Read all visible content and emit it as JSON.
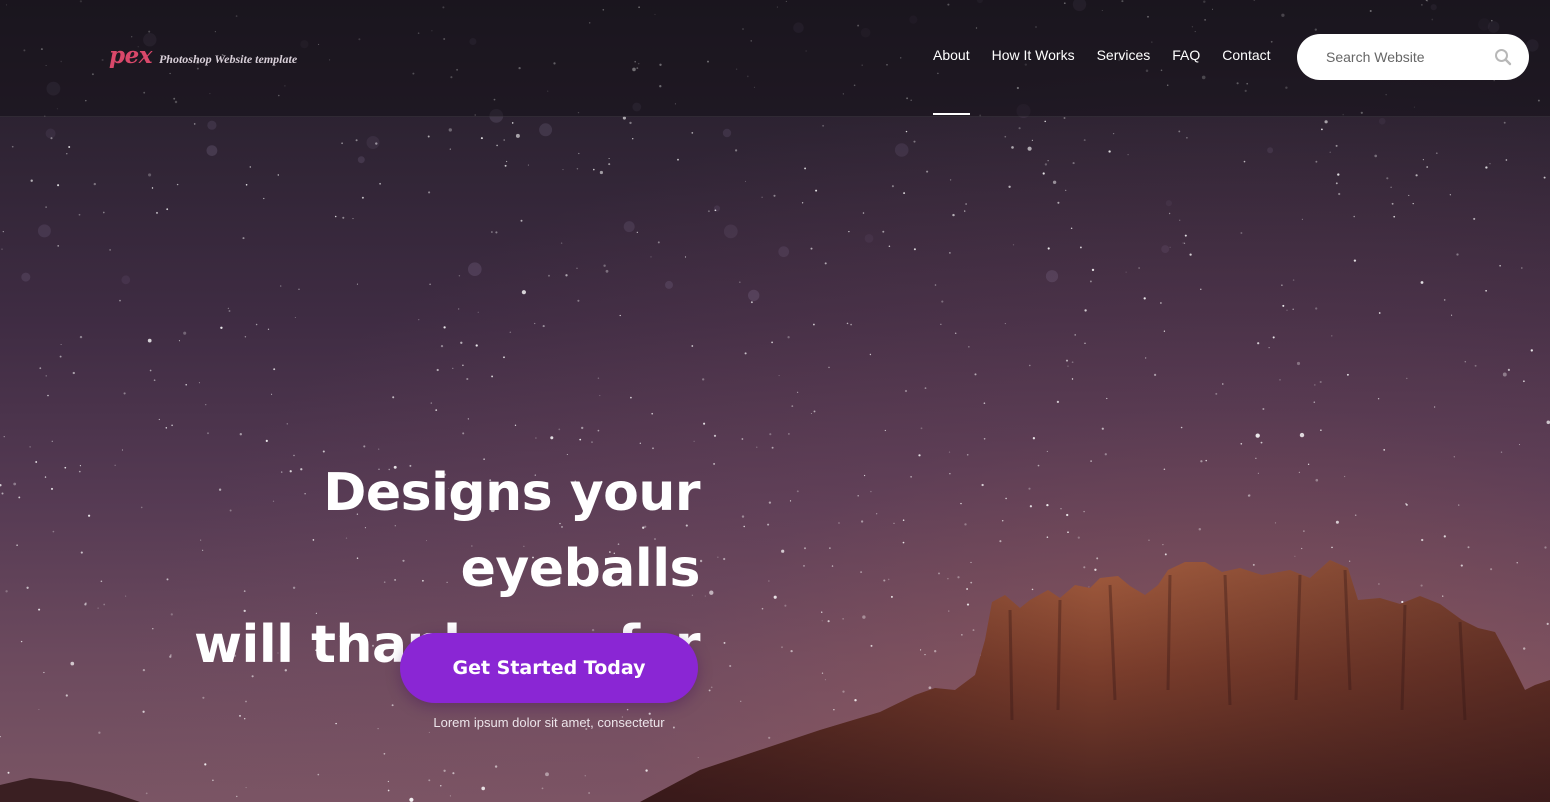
{
  "header": {
    "logo_mark": "pex",
    "logo_tagline": "Photoshop Website template",
    "nav": [
      {
        "label": "About",
        "active": true
      },
      {
        "label": "How It Works",
        "active": false
      },
      {
        "label": "Services",
        "active": false
      },
      {
        "label": "FAQ",
        "active": false
      },
      {
        "label": "Contact",
        "active": false
      }
    ],
    "search": {
      "placeholder": "Search Website",
      "value": ""
    }
  },
  "hero": {
    "headline_line1": "Designs your eyeballs",
    "headline_line2": "will thank you for",
    "cta_label": "Get Started Today",
    "subtext": "Lorem ipsum dolor sit amet, consectetur"
  },
  "colors": {
    "accent": "#8a26d4",
    "logo": "#d9486a",
    "text": "#ffffff"
  },
  "icons": {
    "search": "search-icon"
  }
}
